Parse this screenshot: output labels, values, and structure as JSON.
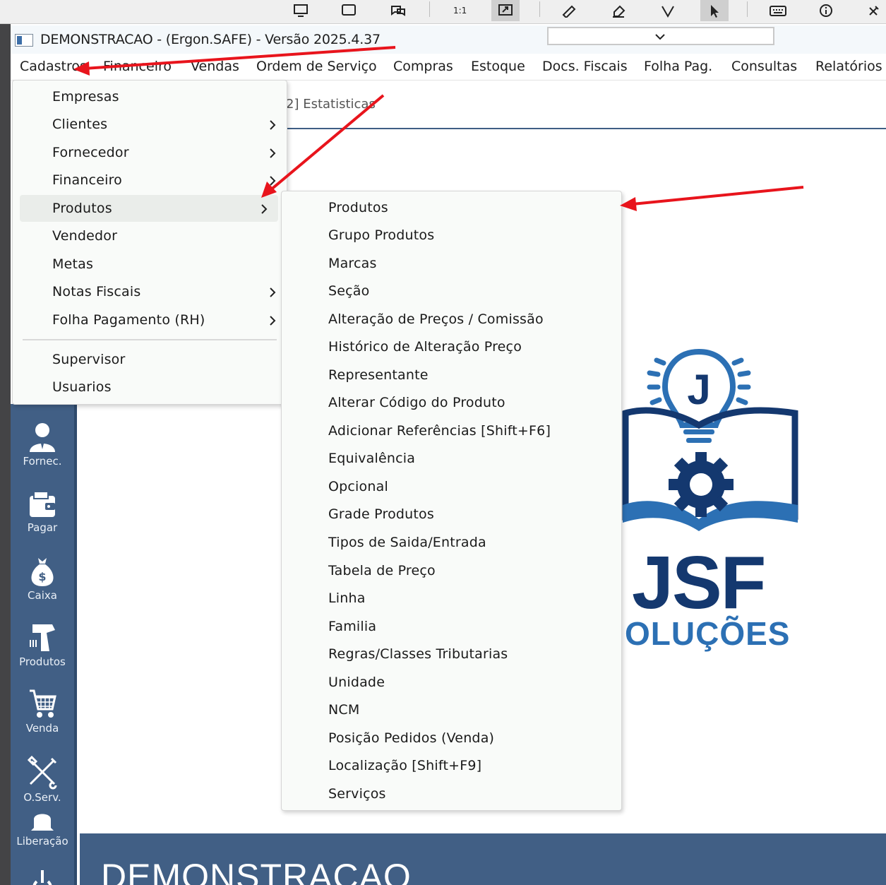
{
  "app": {
    "title": "DEMONSTRACAO - (Ergon.SAFE) - Versão 2025.4.37"
  },
  "menubar": [
    {
      "label": "Cadastros"
    },
    {
      "label": "Financeiro"
    },
    {
      "label": "Vendas"
    },
    {
      "label": "Ordem de Serviço"
    },
    {
      "label": "Compras"
    },
    {
      "label": "Estoque"
    },
    {
      "label": "Docs. Fiscais"
    },
    {
      "label": "Folha Pag."
    },
    {
      "label": "Consultas"
    },
    {
      "label": "Relatórios"
    }
  ],
  "tab": {
    "label": "2] Estatisticas"
  },
  "cadastros_menu": {
    "items": [
      {
        "label": "Empresas",
        "has_submenu": false
      },
      {
        "label": "Clientes",
        "has_submenu": true
      },
      {
        "label": "Fornecedor",
        "has_submenu": true
      },
      {
        "label": "Financeiro",
        "has_submenu": true
      },
      {
        "label": "Produtos",
        "has_submenu": true,
        "highlighted": true
      },
      {
        "label": "Vendedor",
        "has_submenu": false
      },
      {
        "label": "Metas",
        "has_submenu": false
      },
      {
        "label": "Notas Fiscais",
        "has_submenu": true
      },
      {
        "label": "Folha Pagamento (RH)",
        "has_submenu": true
      }
    ],
    "footer_items": [
      {
        "label": "Supervisor"
      },
      {
        "label": "Usuarios"
      }
    ]
  },
  "produtos_menu": {
    "items": [
      "Produtos",
      "Grupo Produtos",
      "Marcas",
      "Seção",
      "Alteração de Preços / Comissão",
      "Histórico de Alteração Preço",
      "Representante",
      "Alterar Código do Produto",
      "Adicionar Referências  [Shift+F6]",
      "Equivalência",
      "Opcional",
      "Grade Produtos",
      "Tipos de Saida/Entrada",
      "Tabela de Preço",
      "Linha",
      "Familia",
      "Regras/Classes Tributarias",
      "Unidade",
      "NCM",
      "Posição Pedidos (Venda)",
      "Localização [Shift+F9]",
      "Serviços"
    ]
  },
  "sidebar": {
    "items": [
      {
        "label": "Fornec.",
        "icon": "person-icon"
      },
      {
        "label": "Pagar",
        "icon": "wallet-icon"
      },
      {
        "label": "Caixa",
        "icon": "money-bag-icon"
      },
      {
        "label": "Produtos",
        "icon": "barcode-scanner-icon"
      },
      {
        "label": "Venda",
        "icon": "shopping-cart-icon"
      },
      {
        "label": "O.Serv.",
        "icon": "tools-icon"
      },
      {
        "label": "Liberação",
        "icon": "bell-icon"
      }
    ]
  },
  "logo": {
    "letter": "J",
    "main": "JSF",
    "sub": "OLUÇÕES"
  },
  "banner": {
    "title": "DEMONSTRACAO"
  },
  "colors": {
    "sidebar": "#415f85",
    "logo_dark": "#14386f",
    "logo_light": "#2c70b4",
    "annotation": "#e8141c"
  }
}
